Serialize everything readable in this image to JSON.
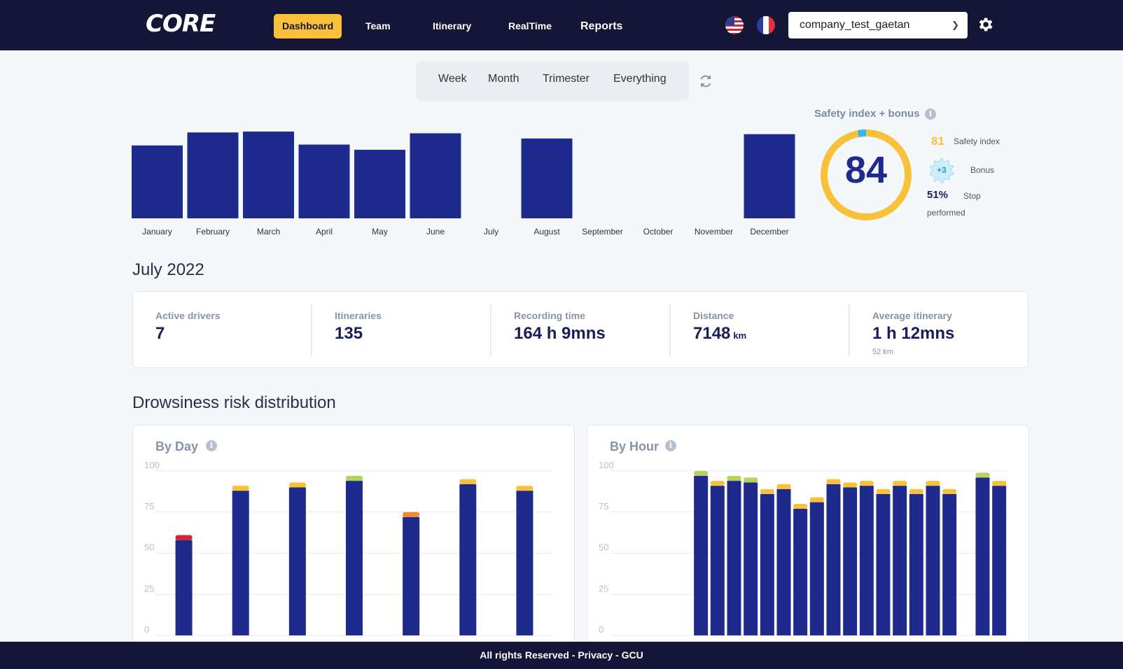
{
  "header": {
    "logo": "CORE",
    "nav": [
      {
        "label": "Dashboard",
        "active": true
      },
      {
        "label": "Team"
      },
      {
        "label": "Itinerary"
      },
      {
        "label": "RealTime"
      },
      {
        "label": "Reports"
      }
    ],
    "languages": [
      "us-flag-icon",
      "fr-flag-icon"
    ],
    "company": "company_test_gaetan",
    "settings_icon": "gear-icon"
  },
  "period_tabs": [
    "Week",
    "Month",
    "Trimester",
    "Everything"
  ],
  "colors": {
    "navy": "#151538",
    "bar": "#1e2a8c",
    "accent": "#f9c13a",
    "green": "#b3d35a",
    "orange": "#ef8a2a",
    "red": "#d9262c",
    "gauge_blue": "#35b6ec"
  },
  "safety": {
    "title": "Safety index + bonus",
    "gauge_value": "84",
    "gauge_fraction": 0.97,
    "safety_index_value": "81",
    "safety_index_label": "Safety index",
    "bonus_value": "+3",
    "bonus_label": "Bonus",
    "stop_value": "51%",
    "stop_label_1": "Stop",
    "stop_label_2": "performed"
  },
  "month_title": "July 2022",
  "stats": [
    {
      "label": "Active drivers",
      "value": "7",
      "unit": "",
      "sub": ""
    },
    {
      "label": "Itineraries",
      "value": "135",
      "unit": "",
      "sub": ""
    },
    {
      "label": "Recording time",
      "value": "164 h 9mns",
      "unit": "",
      "sub": ""
    },
    {
      "label": "Distance",
      "value": "7148",
      "unit": "km",
      "sub": ""
    },
    {
      "label": "Average itinerary",
      "value": "1 h 12mns",
      "unit": "",
      "sub": "52 km"
    }
  ],
  "distribution_title": "Drowsiness risk distribution",
  "by_day_title": "By Day",
  "by_hour_title": "By Hour",
  "footer": "All rights Reserved - Privacy - GCU",
  "chart_data": [
    {
      "type": "bar",
      "categories": [
        "January",
        "February",
        "March",
        "April",
        "May",
        "June",
        "July",
        "August",
        "September",
        "October",
        "November",
        "December"
      ],
      "values": [
        84,
        99,
        100,
        85,
        79,
        98,
        0,
        92,
        0,
        0,
        0,
        97
      ]
    },
    {
      "type": "bar",
      "title": "By Day",
      "ylim": [
        0,
        100
      ],
      "yticks": [
        0,
        25,
        50,
        75,
        100
      ],
      "series": [
        {
          "color": "#1e2a8c",
          "values": [
            58,
            88,
            90,
            94,
            72,
            92,
            88
          ]
        },
        {
          "color": "top",
          "values": [
            3,
            3,
            3,
            3,
            3,
            3,
            3
          ]
        }
      ],
      "top_colors": [
        "#d9262c",
        "#f9c13a",
        "#f9c13a",
        "#b3d35a",
        "#ef8a2a",
        "#f9c13a",
        "#f9c13a"
      ]
    },
    {
      "type": "bar",
      "title": "By Hour",
      "ylim": [
        0,
        100
      ],
      "yticks": [
        0,
        25,
        50,
        75,
        100
      ],
      "series": [
        {
          "color": "#1e2a8c",
          "values": [
            0,
            0,
            0,
            0,
            0,
            97,
            91,
            94,
            93,
            86,
            89,
            77,
            81,
            92,
            90,
            91,
            86,
            91,
            86,
            91,
            86,
            0,
            96,
            91
          ]
        },
        {
          "color": "top",
          "values": [
            0,
            0,
            0,
            0,
            0,
            3,
            3,
            3,
            3,
            3,
            3,
            3,
            3,
            3,
            3,
            3,
            3,
            3,
            3,
            3,
            3,
            0,
            3,
            3
          ]
        }
      ],
      "top_colors": [
        "",
        "",
        "",
        "",
        "",
        "#b3d35a",
        "#f9c13a",
        "#b3d35a",
        "#b3d35a",
        "#f9c13a",
        "#f9c13a",
        "#f9c13a",
        "#f9c13a",
        "#f9c13a",
        "#f9c13a",
        "#f9c13a",
        "#f9c13a",
        "#f9c13a",
        "#f9c13a",
        "#f9c13a",
        "#f9c13a",
        "",
        "#b3d35a",
        "#f9c13a"
      ]
    }
  ]
}
